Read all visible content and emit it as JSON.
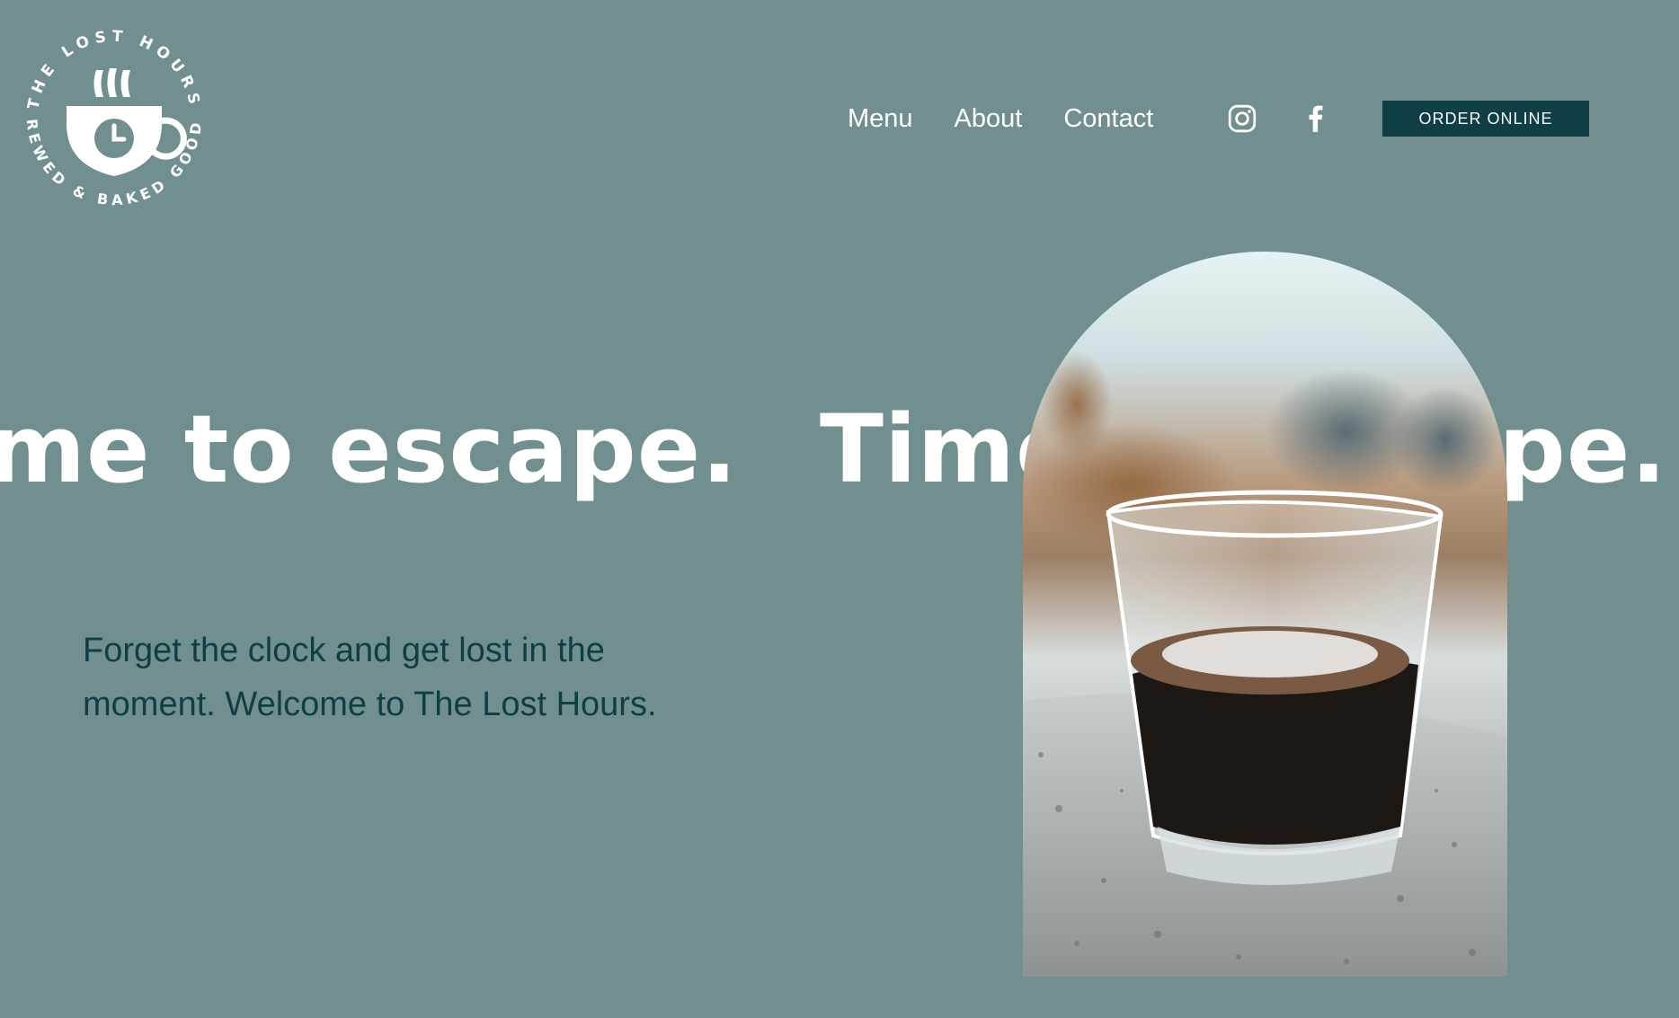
{
  "brand": {
    "logo_top_text": "THE LOST HOURS",
    "logo_bottom_text": "BREWED & BAKED GOODS"
  },
  "nav": {
    "links": [
      {
        "label": "Menu"
      },
      {
        "label": "About"
      },
      {
        "label": "Contact"
      }
    ],
    "social": [
      {
        "icon": "instagram-icon"
      },
      {
        "icon": "facebook-icon"
      }
    ],
    "order_button": "ORDER ONLINE"
  },
  "hero": {
    "marquee_text": "Time to escape.",
    "tagline": "Forget the clock and get lost in the moment. Welcome to The Lost Hours.",
    "image": "espresso-glass-photo"
  },
  "colors": {
    "background": "#728f8f",
    "accent_dark": "#0f3e45",
    "text_light": "#ffffff"
  }
}
